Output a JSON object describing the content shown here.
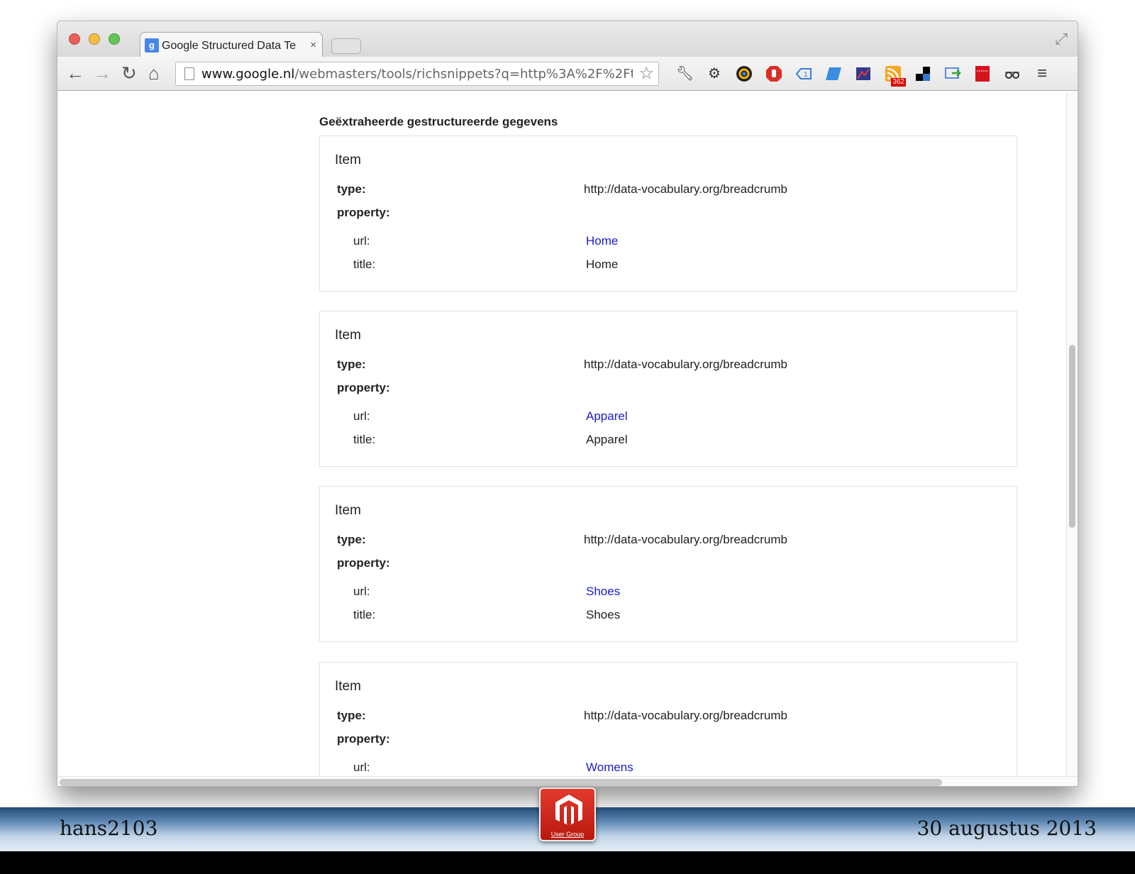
{
  "browser": {
    "tab_title": "Google Structured Data Te",
    "tab_close": "×",
    "url_domain": "www.google.nl",
    "url_path": "/webmasters/tools/richsnippets?q=http%3A%2F%2Ft...",
    "ext_badge": "362",
    "icons": [
      "back-icon",
      "forward-icon",
      "reload-icon",
      "home-icon",
      "page-icon",
      "star-icon",
      "wrench-icon",
      "gear-icon",
      "menu-icon"
    ]
  },
  "page": {
    "heading": "Geëxtraheerde gestructureerde gegevens",
    "items": [
      {
        "title": "Item",
        "type_label": "type:",
        "type_value": "http://data-vocabulary.org/breadcrumb",
        "property_label": "property:",
        "url_label": "url:",
        "url_value": "Home",
        "title_label": "title:",
        "title_value": "Home"
      },
      {
        "title": "Item",
        "type_label": "type:",
        "type_value": "http://data-vocabulary.org/breadcrumb",
        "property_label": "property:",
        "url_label": "url:",
        "url_value": "Apparel",
        "title_label": "title:",
        "title_value": "Apparel"
      },
      {
        "title": "Item",
        "type_label": "type:",
        "type_value": "http://data-vocabulary.org/breadcrumb",
        "property_label": "property:",
        "url_label": "url:",
        "url_value": "Shoes",
        "title_label": "title:",
        "title_value": "Shoes"
      },
      {
        "title": "Item",
        "type_label": "type:",
        "type_value": "http://data-vocabulary.org/breadcrumb",
        "property_label": "property:",
        "url_label": "url:",
        "url_value": "Womens"
      }
    ]
  },
  "footer": {
    "left": "hans2103",
    "right": "30 augustus 2013",
    "logo_text": "User Group"
  },
  "colors": {
    "link": "#1a1acc",
    "footer_dark": "#224a73",
    "logo_red": "#d0281c"
  }
}
